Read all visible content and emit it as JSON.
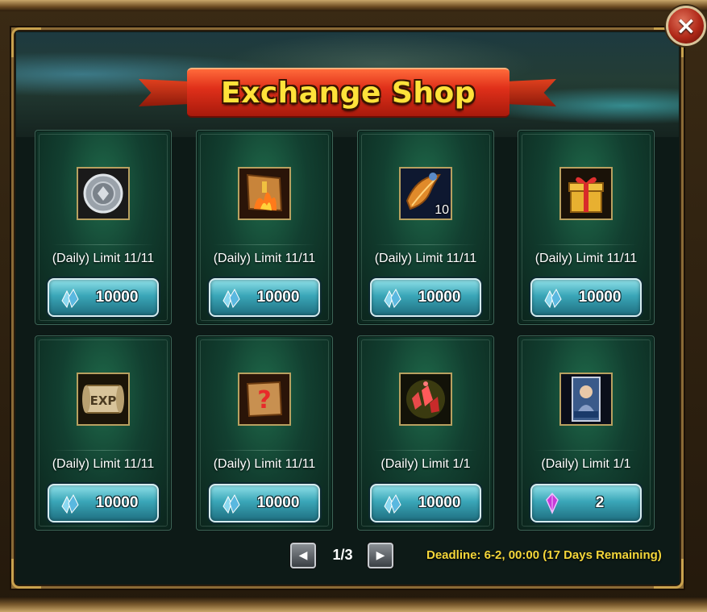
{
  "window": {
    "title": "Exchange Shop",
    "close_glyph": "×"
  },
  "colors": {
    "title_text": "#ffe23a",
    "ribbon": "#e0301a",
    "card_bg": "#123f30",
    "price_button": "#3aa6b8",
    "deadline_text": "#f5d73a"
  },
  "items": [
    {
      "icon": "silver-medal-icon",
      "quantity": "",
      "limit": "(Daily) Limit 11/11",
      "currency_icon": "blue-crystal-icon",
      "price": "10000"
    },
    {
      "icon": "fire-scroll-icon",
      "quantity": "",
      "limit": "(Daily) Limit 11/11",
      "currency_icon": "blue-crystal-icon",
      "price": "10000"
    },
    {
      "icon": "feather-quill-icon",
      "quantity": "10",
      "limit": "(Daily) Limit 11/11",
      "currency_icon": "blue-crystal-icon",
      "price": "10000"
    },
    {
      "icon": "gift-box-icon",
      "quantity": "",
      "limit": "(Daily) Limit 11/11",
      "currency_icon": "blue-crystal-icon",
      "price": "10000"
    },
    {
      "icon": "exp-scroll-icon",
      "quantity": "",
      "limit": "(Daily) Limit 11/11",
      "currency_icon": "blue-crystal-icon",
      "price": "10000"
    },
    {
      "icon": "mystery-scroll-icon",
      "quantity": "",
      "limit": "(Daily) Limit 11/11",
      "currency_icon": "blue-crystal-icon",
      "price": "10000"
    },
    {
      "icon": "red-crystal-shards-icon",
      "quantity": "",
      "limit": "(Daily) Limit 1/1",
      "currency_icon": "blue-crystal-icon",
      "price": "10000"
    },
    {
      "icon": "hero-card-icon",
      "quantity": "",
      "limit": "(Daily) Limit 1/1",
      "currency_icon": "purple-gem-icon",
      "price": "2"
    }
  ],
  "pagination": {
    "current": "1/3",
    "prev_glyph": "◀",
    "next_glyph": "▶"
  },
  "deadline": "Deadline: 6-2, 00:00 (17 Days Remaining)"
}
